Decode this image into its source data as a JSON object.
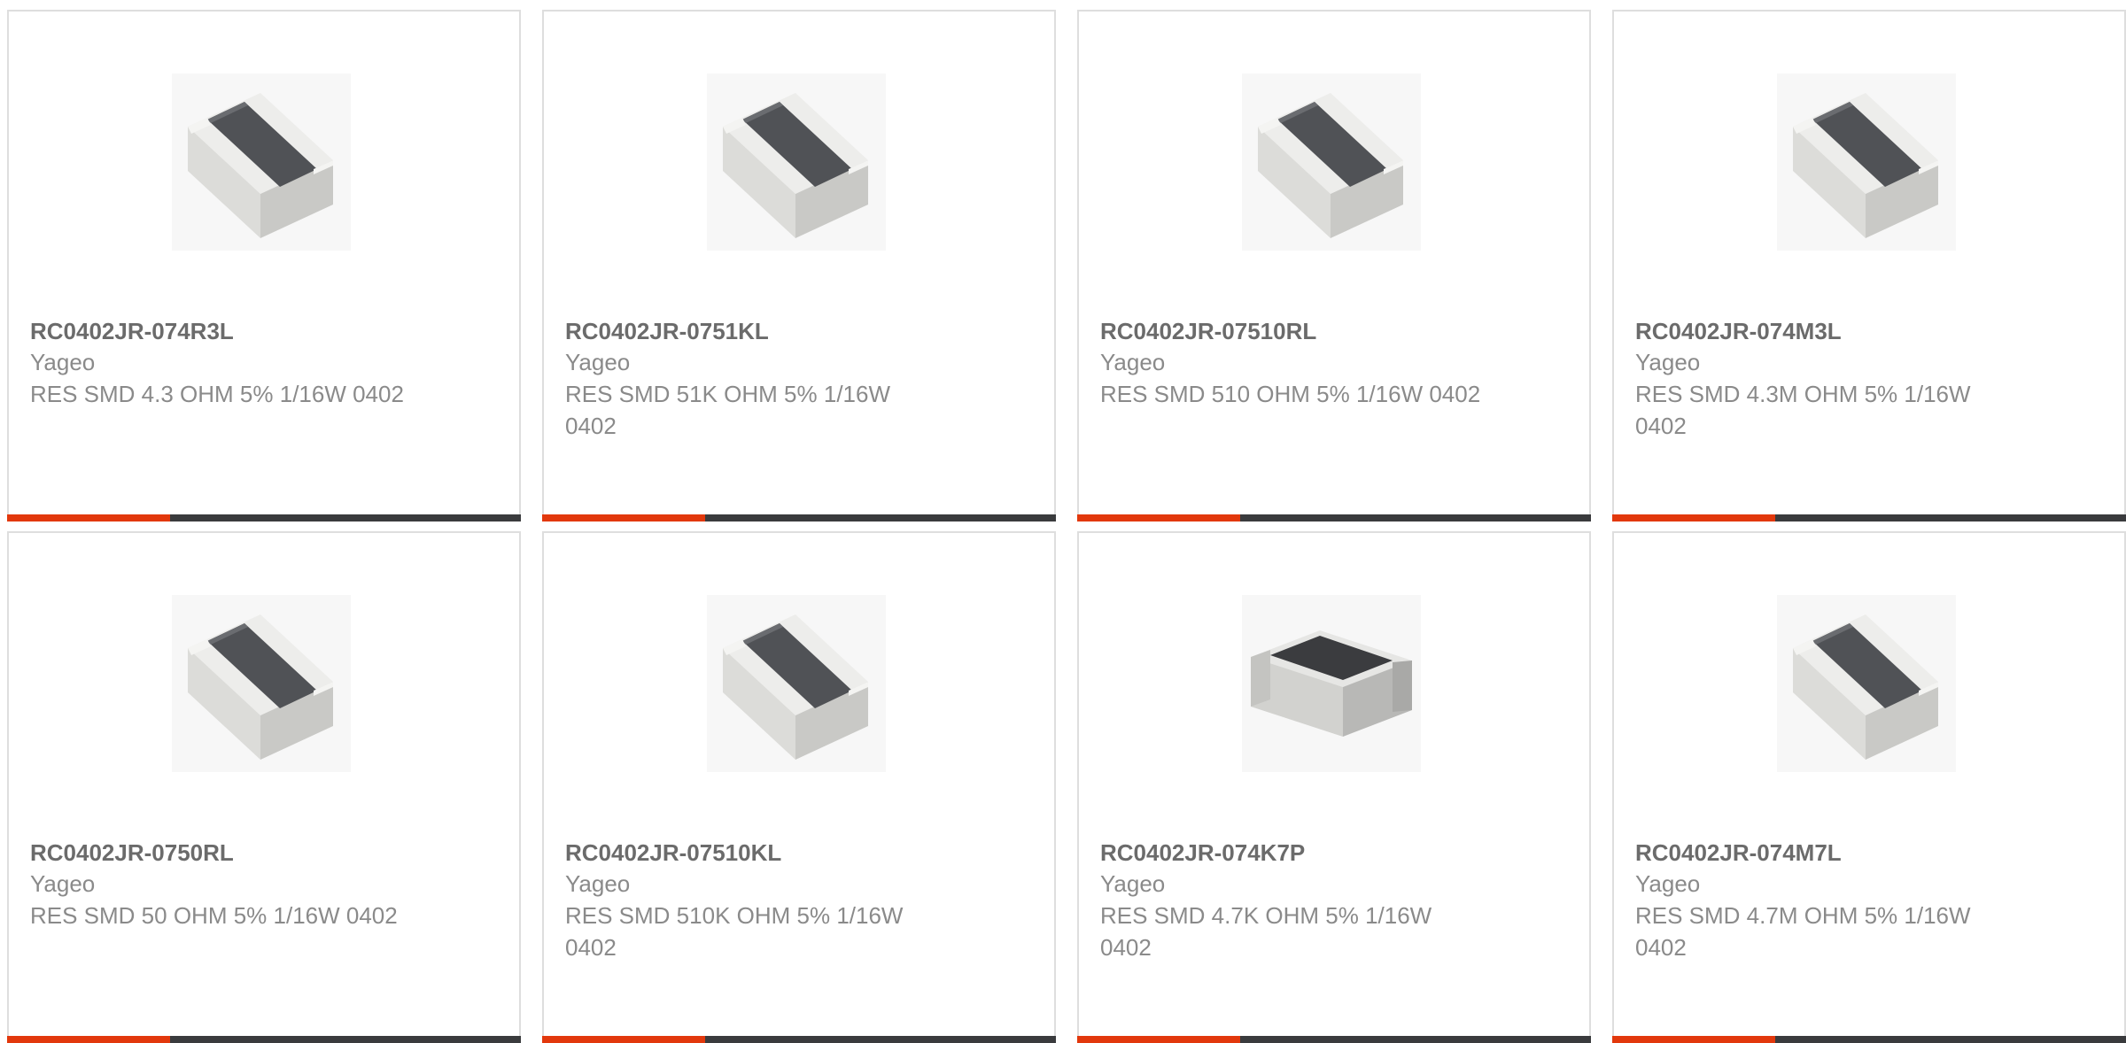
{
  "products": [
    {
      "part": "RC0402JR-074R3L",
      "manufacturer": "Yageo",
      "description": "RES SMD 4.3 OHM 5% 1/16W 0402",
      "image": "chip-resistor-top-image"
    },
    {
      "part": "RC0402JR-0751KL",
      "manufacturer": "Yageo",
      "description": "RES SMD 51K OHM 5% 1/16W 0402",
      "image": "chip-resistor-top-image"
    },
    {
      "part": "RC0402JR-07510RL",
      "manufacturer": "Yageo",
      "description": "RES SMD 510 OHM 5% 1/16W 0402",
      "image": "chip-resistor-top-image"
    },
    {
      "part": "RC0402JR-074M3L",
      "manufacturer": "Yageo",
      "description": "RES SMD 4.3M OHM 5% 1/16W 0402",
      "image": "chip-resistor-top-image"
    },
    {
      "part": "RC0402JR-0750RL",
      "manufacturer": "Yageo",
      "description": "RES SMD 50 OHM 5% 1/16W 0402",
      "image": "chip-resistor-top-image"
    },
    {
      "part": "RC0402JR-07510KL",
      "manufacturer": "Yageo",
      "description": "RES SMD 510K OHM 5% 1/16W 0402",
      "image": "chip-resistor-top-image"
    },
    {
      "part": "RC0402JR-074K7P",
      "manufacturer": "Yageo",
      "description": "RES SMD 4.7K OHM 5% 1/16W 0402",
      "image": "chip-resistor-side-image"
    },
    {
      "part": "RC0402JR-074M7L",
      "manufacturer": "Yageo",
      "description": "RES SMD 4.7M OHM 5% 1/16W 0402",
      "image": "chip-resistor-top-image"
    }
  ],
  "colors": {
    "accent": "#e2380c",
    "bar_dark": "#3a3b3d",
    "border": "#dedede",
    "part_text": "#6b6b6b",
    "secondary_text": "#8a8a8a"
  }
}
